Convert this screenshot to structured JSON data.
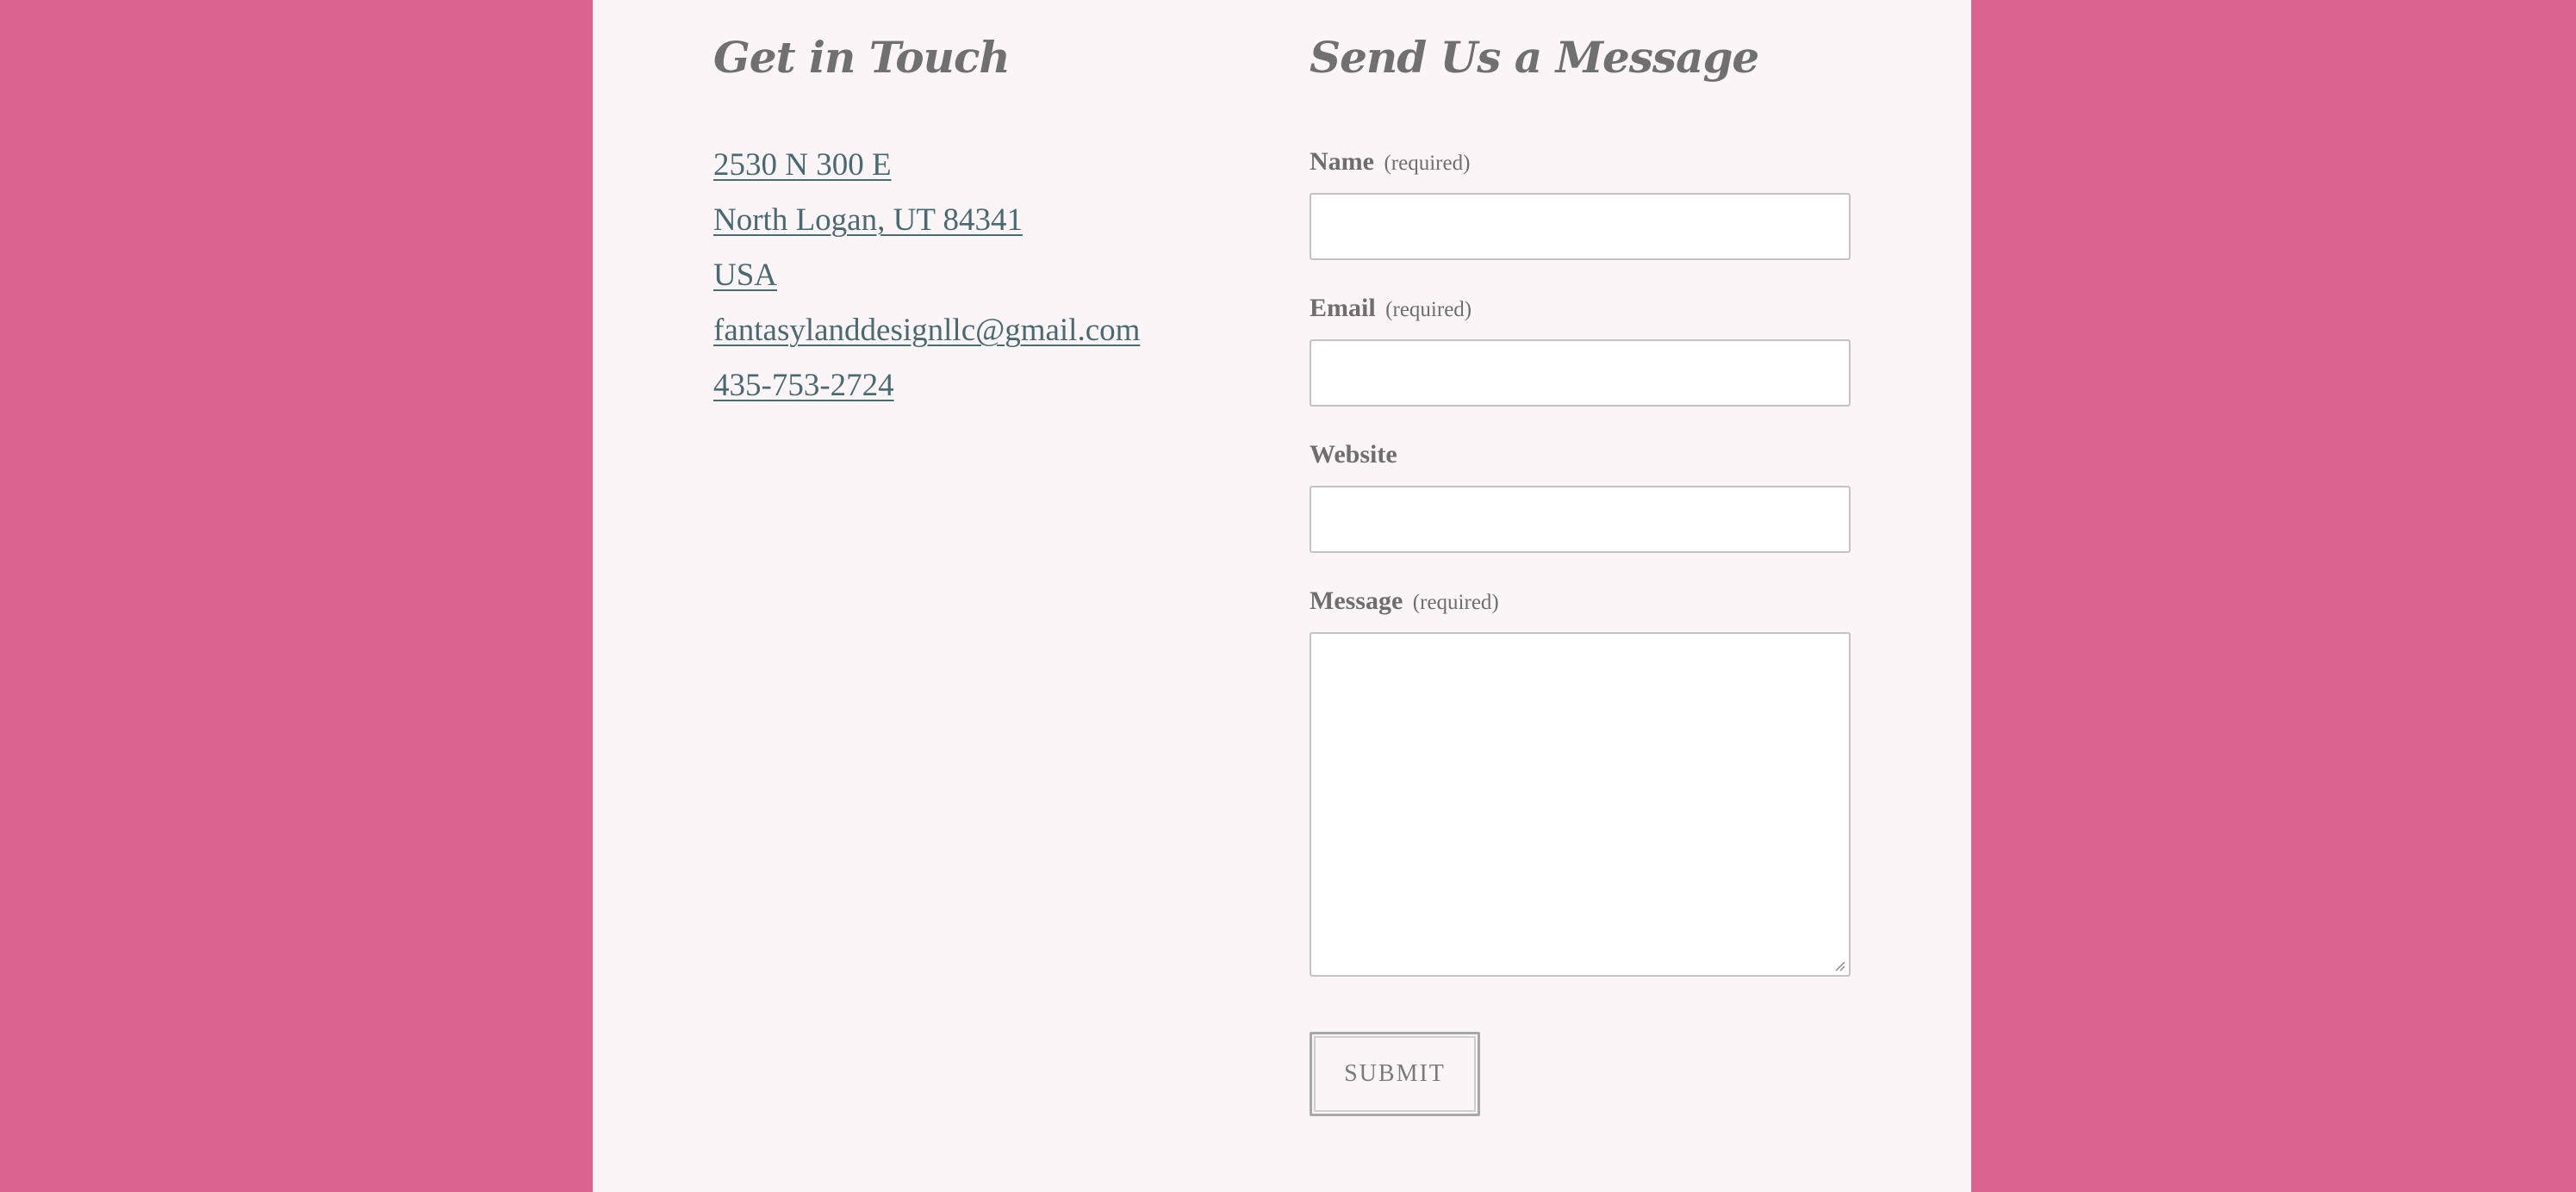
{
  "contact_info": {
    "heading": "Get in Touch",
    "address_line1": "2530 N 300 E",
    "address_line2": "North Logan, UT 84341",
    "country": "USA",
    "email": "fantasylanddesignllc@gmail.com",
    "phone": "435-753-2724"
  },
  "contact_form": {
    "heading": "Send Us a Message",
    "name_label": "Name",
    "name_required": "(required)",
    "email_label": "Email",
    "email_required": "(required)",
    "website_label": "Website",
    "message_label": "Message",
    "message_required": "(required)",
    "name_value": "",
    "email_value": "",
    "website_value": "",
    "message_value": "",
    "submit_label": "SUBMIT"
  },
  "colors": {
    "background": "#dc6590",
    "panel": "#fcf5f7",
    "link": "#4a6a72",
    "heading": "#707070"
  }
}
